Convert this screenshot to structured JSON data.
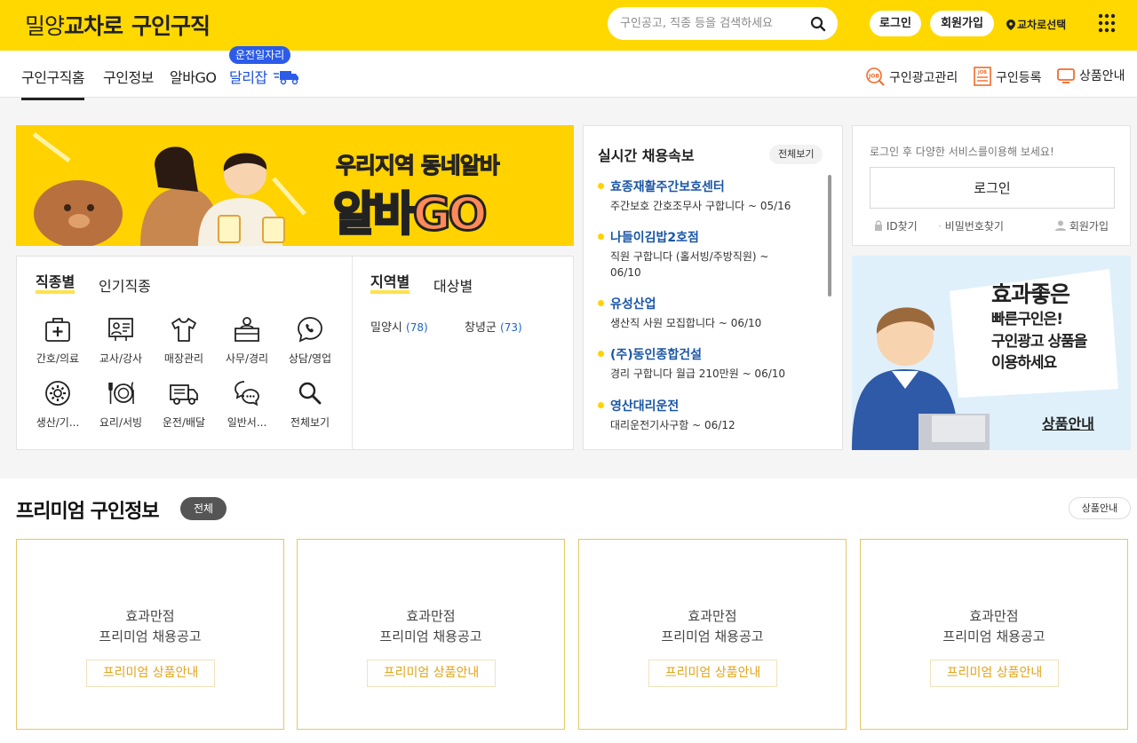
{
  "header": {
    "brand_part1": "밀양",
    "brand_part2": "교차로",
    "brand_part3": "구인구직",
    "search_placeholder": "구인공고, 직종 등을 검색하세요",
    "login_label": "로그인",
    "join_label": "회원가입",
    "region_label": "교차로선택"
  },
  "nav": {
    "tabs": [
      {
        "label": "구인구직홈"
      },
      {
        "label": "구인정보"
      },
      {
        "label": "알바GO"
      },
      {
        "label": "달리잡"
      }
    ],
    "badge": "운전일자리",
    "right_links": [
      {
        "label": "구인광고관리"
      },
      {
        "label": "구인등록"
      },
      {
        "label": "상품안내"
      }
    ]
  },
  "banner": {
    "line1": "우리지역 동네알바",
    "line2_a": "알바",
    "line2_b": "GO"
  },
  "category": {
    "tab_job": "직종별",
    "tab_popular": "인기직종",
    "tab_region": "지역별",
    "tab_target": "대상별",
    "items": [
      {
        "label": "간호/의료",
        "icon": "medical-kit-icon"
      },
      {
        "label": "교사/강사",
        "icon": "teacher-board-icon"
      },
      {
        "label": "매장관리",
        "icon": "shirt-icon"
      },
      {
        "label": "사무/경리",
        "icon": "office-desk-icon"
      },
      {
        "label": "상담/영업",
        "icon": "phone-chat-icon"
      },
      {
        "label": "생산/기...",
        "icon": "gear-icon"
      },
      {
        "label": "요리/서빙",
        "icon": "dish-cutlery-icon"
      },
      {
        "label": "운전/배달",
        "icon": "truck-icon"
      },
      {
        "label": "일반서...",
        "icon": "chat-bubbles-icon"
      },
      {
        "label": "전체보기",
        "icon": "search-icon"
      }
    ],
    "regions": [
      {
        "name": "밀양시",
        "count": "(78)"
      },
      {
        "name": "창녕군",
        "count": "(73)"
      }
    ]
  },
  "realtime": {
    "title": "실시간 채용속보",
    "more_label": "전체보기",
    "items": [
      {
        "company": "효종재활주간보호센터",
        "desc": "주간보호 간호조무사 구합니다 ~ 05/16"
      },
      {
        "company": "나들이김밥2호점",
        "desc": "직원 구합니다 (홀서빙/주방직원) ~ 06/10"
      },
      {
        "company": "유성산업",
        "desc": "생산직 사원 모집합니다 ~ 06/10"
      },
      {
        "company": "(주)동인종합건설",
        "desc": "경리 구합니다 월급 210만원 ~ 06/10"
      },
      {
        "company": "영산대리운전",
        "desc": "대리운전기사구함 ~ 06/12"
      }
    ]
  },
  "login_box": {
    "hint": "로그인 후 다양한 서비스를이용해 보세요!",
    "login_button": "로그인",
    "find_id": "ID찾기",
    "find_pw": "비밀번호찾기",
    "join": "회원가입"
  },
  "ad": {
    "line1": "효과좋은",
    "line2": "빠른구인은!",
    "line3": "구인광고 상품을",
    "line4": "이용하세요",
    "link": "상품안내"
  },
  "premium": {
    "title": "프리미엄 구인정보",
    "all_label": "전체",
    "guide_label": "상품안내",
    "cards": [
      {
        "line1": "효과만점",
        "line2": "프리미엄 채용공고",
        "button": "프리미엄 상품안내"
      },
      {
        "line1": "효과만점",
        "line2": "프리미엄 채용공고",
        "button": "프리미엄 상품안내"
      },
      {
        "line1": "효과만점",
        "line2": "프리미엄 채용공고",
        "button": "프리미엄 상품안내"
      },
      {
        "line1": "효과만점",
        "line2": "프리미엄 채용공고",
        "button": "프리미엄 상품안내"
      }
    ]
  },
  "colors": {
    "brand_yellow": "#ffd800",
    "link_blue": "#1a56a8",
    "badge_blue": "#2b5be8",
    "premium_gold": "#e2a41a"
  }
}
